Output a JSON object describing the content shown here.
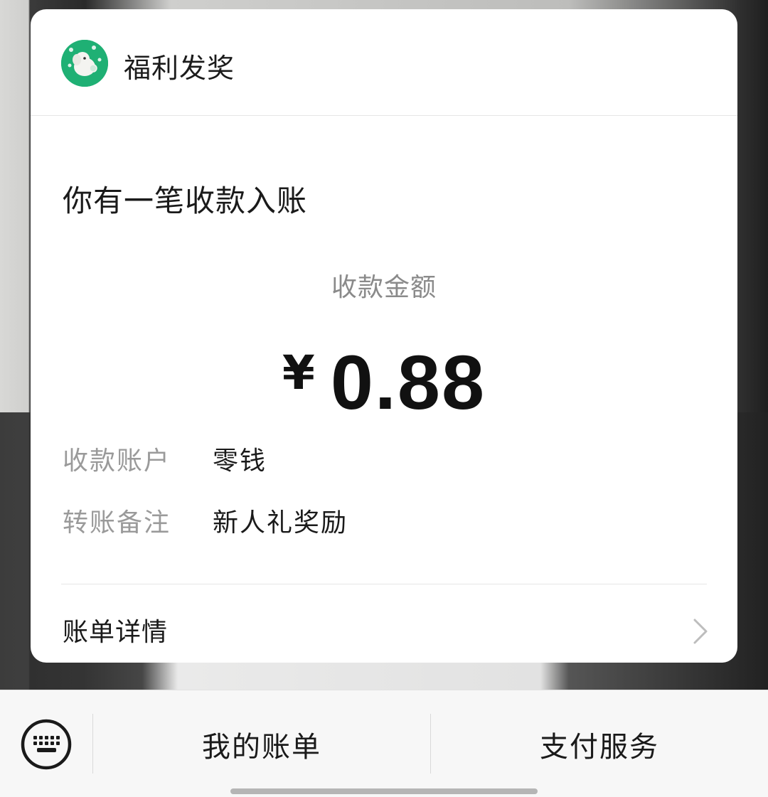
{
  "card": {
    "brand_name": "福利发奖",
    "headline": "你有一笔收款入账",
    "amount_label": "收款金额",
    "currency_symbol": "¥",
    "amount": "0.88",
    "info": [
      {
        "key": "收款账户",
        "value": "零钱"
      },
      {
        "key": "转账备注",
        "value": "新人礼奖励"
      }
    ],
    "detail_label": "账单详情"
  },
  "bottom_menu": {
    "left_label": "我的账单",
    "right_label": "支付服务"
  },
  "colors": {
    "brand_green": "#1fb074",
    "label_gray": "#9a9a9a",
    "text_dark": "#1a1a1a"
  },
  "icons": {
    "logo": "elephant-logo-icon",
    "chevron": "chevron-right-icon",
    "keyboard": "keyboard-icon"
  }
}
